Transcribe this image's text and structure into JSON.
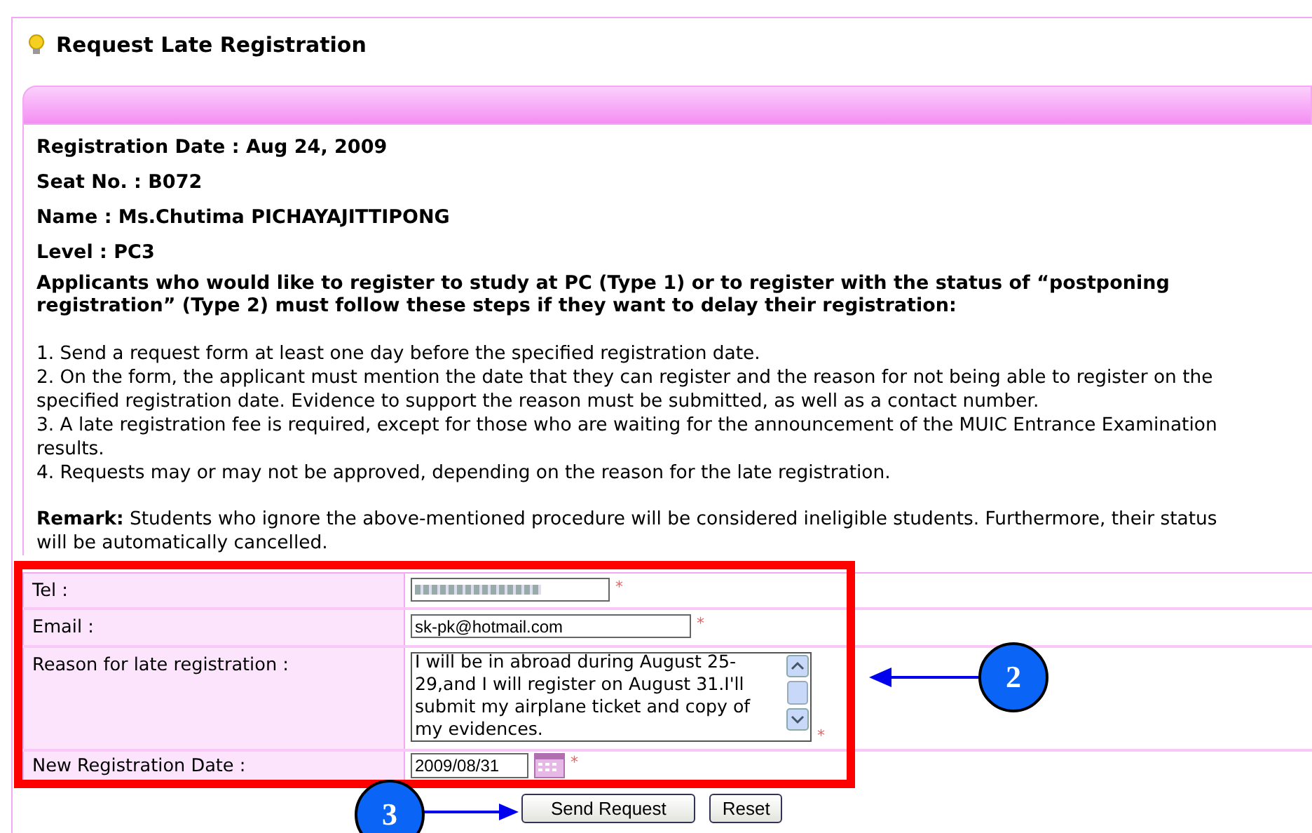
{
  "title": "Request Late Registration",
  "info": [
    "Registration Date : Aug 24, 2009",
    "Seat No. : B072",
    "Name : Ms.Chutima PICHAYAJITTIPONG",
    "Level : PC3"
  ],
  "intro": "Applicants who would like to register to study at PC (Type 1) or to register with the status of “postponing registration” (Type 2) must follow these steps if they want to delay their registration:",
  "steps": [
    "1. Send a request form at least one day before the specified registration date.",
    "2. On the form, the applicant must mention the date that they can register and the reason for not being able to register on the specified registration date. Evidence to support the reason must be submitted, as well as a contact number.",
    "3. A late registration fee is required, except for those who are waiting for the announcement of the MUIC Entrance Examination results.",
    "4. Requests may or may not be approved, depending on the reason for the late registration."
  ],
  "remark": "**Remark:** Students who ignore the above-mentioned procedure will be considered ineligible students. Furthermore, their status will be automatically cancelled.",
  "form": [
    {
      "kind": "redacted",
      "label": "Tel :",
      "required": "*"
    },
    {
      "kind": "text",
      "label": "Email :",
      "value": "sk-pk@hotmail.com",
      "required": "*"
    },
    {
      "kind": "textarea",
      "label": "Reason for late registration :",
      "value": "I will be in abroad during August 25-29,and I will register on August 31.I'll submit my airplane ticket and copy of my evidences.",
      "required": "*"
    },
    {
      "kind": "date",
      "label": "New Registration Date :",
      "value": "2009/08/31",
      "required": "*"
    }
  ],
  "buttons": [
    "Send Request",
    "Reset"
  ],
  "callouts": [
    "2",
    "3"
  ]
}
